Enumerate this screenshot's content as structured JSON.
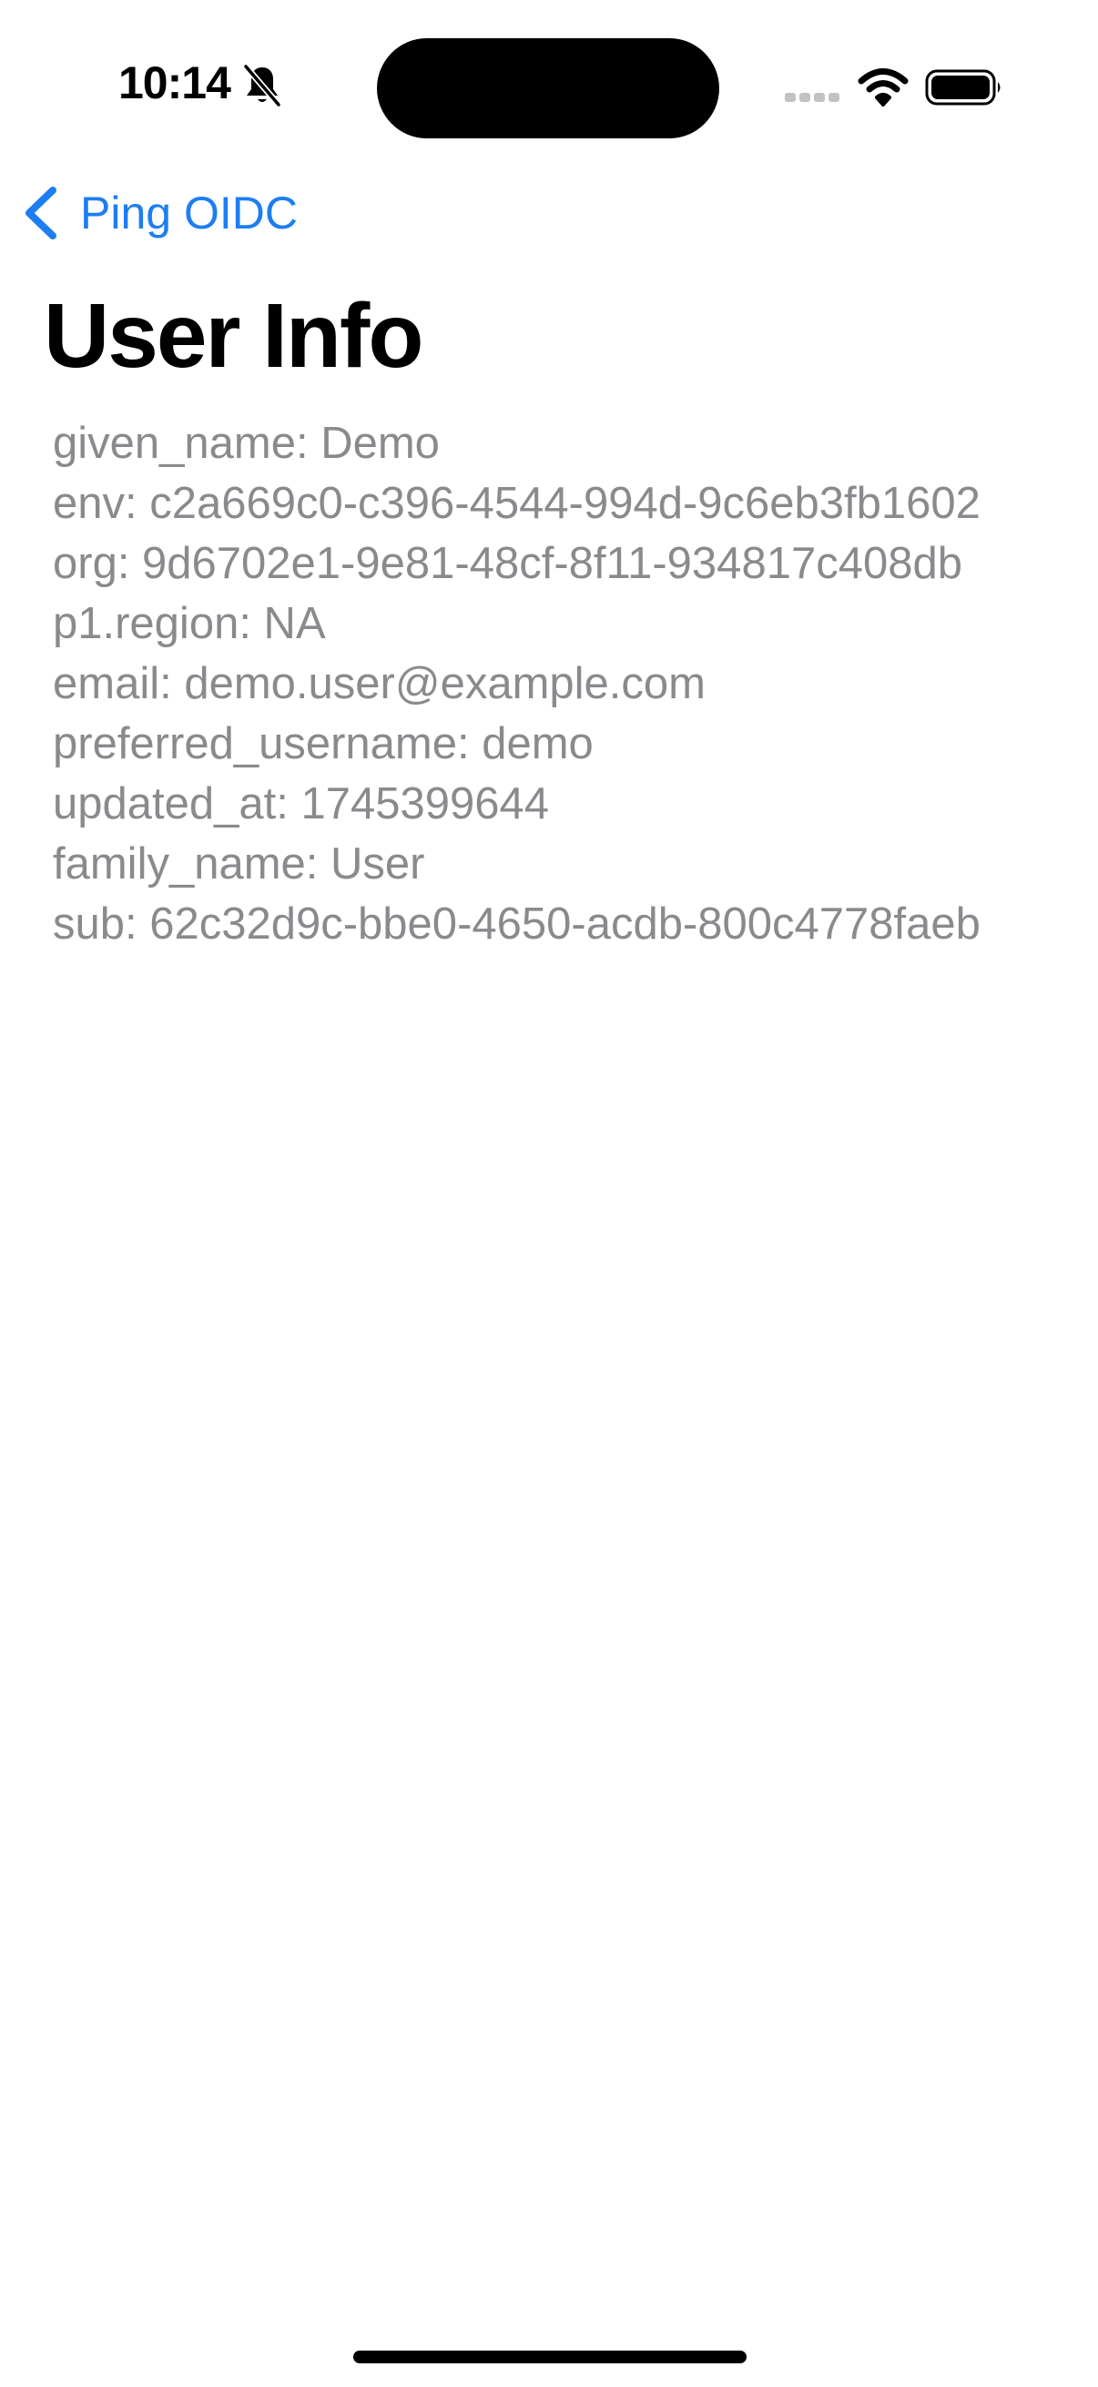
{
  "status_bar": {
    "time": "10:14"
  },
  "nav": {
    "back_label": "Ping OIDC"
  },
  "page": {
    "title": "User Info"
  },
  "user_info": [
    "given_name: Demo",
    "env: c2a669c0-c396-4544-994d-9c6eb3fb1602",
    "org: 9d6702e1-9e81-48cf-8f11-934817c408db",
    "p1.region: NA",
    "email: demo.user@example.com",
    "preferred_username: demo",
    "updated_at: 1745399644",
    "family_name: User",
    "sub: 62c32d9c-bbe0-4650-acdb-800c4778faeb"
  ],
  "colors": {
    "accent": "#1d7ef2",
    "secondary_text": "#8a8a8e"
  },
  "icons": [
    "bell-slash-icon",
    "cellular-signal-icon",
    "wifi-icon",
    "battery-icon",
    "chevron-left-icon"
  ]
}
